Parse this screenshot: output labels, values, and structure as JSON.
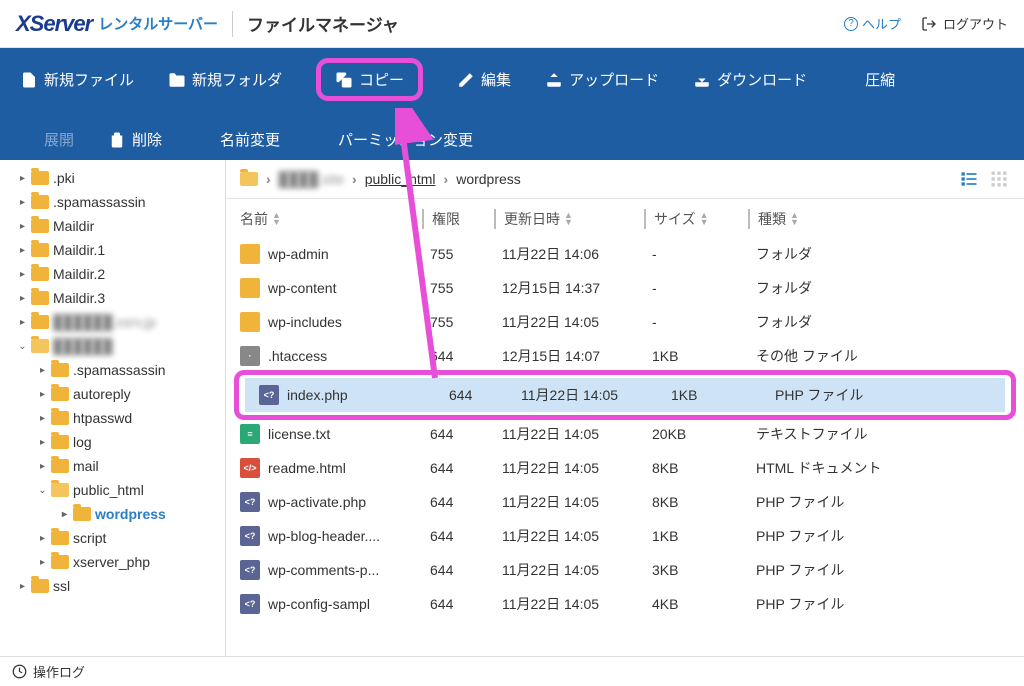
{
  "header": {
    "brand": "XServer",
    "brand_sub": "レンタルサーバー",
    "app_title": "ファイルマネージャ",
    "help": "ヘルプ",
    "logout": "ログアウト"
  },
  "toolbar": {
    "new_file": "新規ファイル",
    "new_folder": "新規フォルダ",
    "copy": "コピー",
    "edit": "編集",
    "upload": "アップロード",
    "download": "ダウンロード",
    "compress": "圧縮",
    "expand": "展開",
    "delete": "削除",
    "rename": "名前変更",
    "permission": "パーミッション変更"
  },
  "tree": [
    {
      "depth": 1,
      "caret": "▸",
      "label": ".pki",
      "open": false
    },
    {
      "depth": 1,
      "caret": "▸",
      "label": ".spamassassin",
      "open": false
    },
    {
      "depth": 1,
      "caret": "▸",
      "label": "Maildir",
      "open": false
    },
    {
      "depth": 1,
      "caret": "▸",
      "label": "Maildir.1",
      "open": false
    },
    {
      "depth": 1,
      "caret": "▸",
      "label": "Maildir.2",
      "open": false
    },
    {
      "depth": 1,
      "caret": "▸",
      "label": "Maildir.3",
      "open": false
    },
    {
      "depth": 1,
      "caret": "▸",
      "label": "██████.xsrv.jp",
      "open": false,
      "blur": true
    },
    {
      "depth": 1,
      "caret": "⌄",
      "label": "██████",
      "open": true,
      "blur": true
    },
    {
      "depth": 2,
      "caret": "▸",
      "label": ".spamassassin",
      "open": false
    },
    {
      "depth": 2,
      "caret": "▸",
      "label": "autoreply",
      "open": false
    },
    {
      "depth": 2,
      "caret": "▸",
      "label": "htpasswd",
      "open": false
    },
    {
      "depth": 2,
      "caret": "▸",
      "label": "log",
      "open": false
    },
    {
      "depth": 2,
      "caret": "▸",
      "label": "mail",
      "open": false
    },
    {
      "depth": 2,
      "caret": "⌄",
      "label": "public_html",
      "open": true
    },
    {
      "depth": 3,
      "caret": "▸",
      "label": "wordpress",
      "open": false,
      "active": true
    },
    {
      "depth": 2,
      "caret": "▸",
      "label": "script",
      "open": false
    },
    {
      "depth": 2,
      "caret": "▸",
      "label": "xserver_php",
      "open": false
    },
    {
      "depth": 1,
      "caret": "▸",
      "label": "ssl",
      "open": false
    }
  ],
  "breadcrumb": {
    "site": "████.site",
    "public_html": "public_html",
    "wordpress": "wordpress"
  },
  "columns": {
    "name": "名前",
    "perm": "権限",
    "date": "更新日時",
    "size": "サイズ",
    "type": "種類"
  },
  "files": [
    {
      "icon": "folder",
      "name": "wp-admin",
      "perm": "755",
      "date": "11月22日 14:06",
      "size": "-",
      "type": "フォルダ"
    },
    {
      "icon": "folder",
      "name": "wp-content",
      "perm": "755",
      "date": "12月15日 14:37",
      "size": "-",
      "type": "フォルダ"
    },
    {
      "icon": "folder",
      "name": "wp-includes",
      "perm": "755",
      "date": "11月22日 14:05",
      "size": "-",
      "type": "フォルダ"
    },
    {
      "icon": "file",
      "name": ".htaccess",
      "perm": "644",
      "date": "12月15日 14:07",
      "size": "1KB",
      "type": "その他 ファイル"
    },
    {
      "icon": "php",
      "name": "index.php",
      "perm": "644",
      "date": "11月22日 14:05",
      "size": "1KB",
      "type": "PHP ファイル",
      "selected": true,
      "highlight": true
    },
    {
      "icon": "txt",
      "name": "license.txt",
      "perm": "644",
      "date": "11月22日 14:05",
      "size": "20KB",
      "type": "テキストファイル"
    },
    {
      "icon": "html",
      "name": "readme.html",
      "perm": "644",
      "date": "11月22日 14:05",
      "size": "8KB",
      "type": "HTML ドキュメント"
    },
    {
      "icon": "php",
      "name": "wp-activate.php",
      "perm": "644",
      "date": "11月22日 14:05",
      "size": "8KB",
      "type": "PHP ファイル"
    },
    {
      "icon": "php",
      "name": "wp-blog-header....",
      "perm": "644",
      "date": "11月22日 14:05",
      "size": "1KB",
      "type": "PHP ファイル"
    },
    {
      "icon": "php",
      "name": "wp-comments-p...",
      "perm": "644",
      "date": "11月22日 14:05",
      "size": "3KB",
      "type": "PHP ファイル"
    },
    {
      "icon": "php",
      "name": "wp-config-sampl",
      "perm": "644",
      "date": "11月22日 14:05",
      "size": "4KB",
      "type": "PHP ファイル"
    }
  ],
  "footer": {
    "log": "操作ログ"
  }
}
